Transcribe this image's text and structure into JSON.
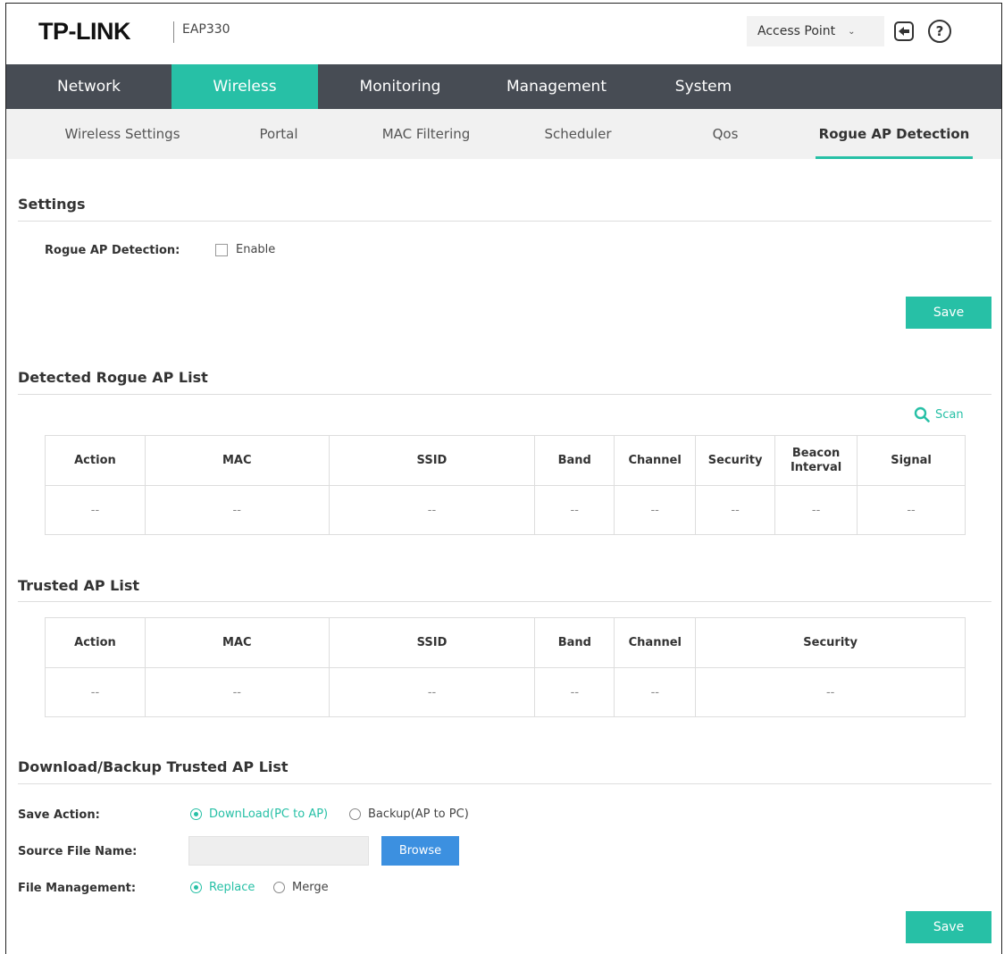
{
  "header": {
    "brand": "TP-LINK",
    "model": "EAP330",
    "mode": "Access Point"
  },
  "mainnav": [
    "Network",
    "Wireless",
    "Monitoring",
    "Management",
    "System"
  ],
  "subnav": [
    "Wireless Settings",
    "Portal",
    "MAC Filtering",
    "Scheduler",
    "Qos",
    "Rogue AP Detection"
  ],
  "settings": {
    "title": "Settings",
    "rogue_label": "Rogue AP Detection:",
    "enable_label": "Enable",
    "save_label": "Save"
  },
  "detected": {
    "title": "Detected Rogue AP List",
    "scan_label": "Scan",
    "headers": [
      "Action",
      "MAC",
      "SSID",
      "Band",
      "Channel",
      "Security",
      "Beacon Interval",
      "Signal"
    ],
    "row": [
      "--",
      "--",
      "--",
      "--",
      "--",
      "--",
      "--",
      "--"
    ]
  },
  "trusted": {
    "title": "Trusted AP List",
    "headers": [
      "Action",
      "MAC",
      "SSID",
      "Band",
      "Channel",
      "Security"
    ],
    "row": [
      "--",
      "--",
      "--",
      "--",
      "--",
      "--"
    ]
  },
  "backup": {
    "title": "Download/Backup Trusted AP List",
    "save_action_label": "Save Action:",
    "save_action_options": [
      "DownLoad(PC to AP)",
      "Backup(AP to PC)"
    ],
    "source_label": "Source File Name:",
    "browse_label": "Browse",
    "file_mgmt_label": "File Management:",
    "file_mgmt_options": [
      "Replace",
      "Merge"
    ],
    "save_label": "Save"
  },
  "colors": {
    "accent": "#27c0a6",
    "nav_bg": "#474c54",
    "browse": "#3c90e0"
  }
}
